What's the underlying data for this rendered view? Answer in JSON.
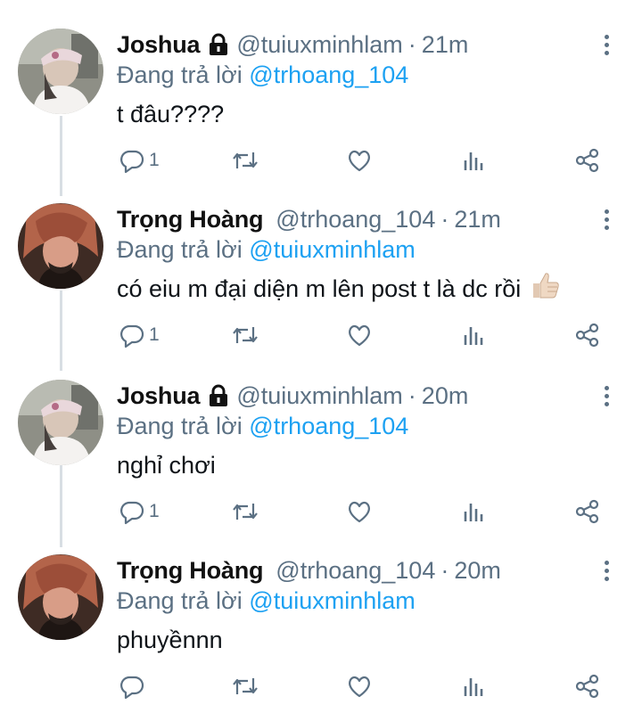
{
  "colors": {
    "link": "#1da1f2",
    "secondary": "#5b7083",
    "thread_line": "#d8dee3",
    "text": "#0f1419"
  },
  "reply_prefix": "Đang trả lời",
  "tweets": [
    {
      "name": "Joshua",
      "protected": true,
      "handle": "@tuiuxminhlam",
      "separator": "·",
      "time": "21m",
      "reply_to": "@trhoang_104",
      "text": "t đâu????",
      "emoji": "",
      "reply_count": "1"
    },
    {
      "name": "Trọng Hoàng",
      "protected": false,
      "handle": "@trhoang_104",
      "separator": "·",
      "time": "21m",
      "reply_to": "@tuiuxminhlam",
      "text": "có eiu m đại diện m lên post t là dc rồi",
      "emoji": "thumbs-up",
      "reply_count": "1"
    },
    {
      "name": "Joshua",
      "protected": true,
      "handle": "@tuiuxminhlam",
      "separator": "·",
      "time": "20m",
      "reply_to": "@trhoang_104",
      "text": "nghỉ chơi",
      "emoji": "",
      "reply_count": "1"
    },
    {
      "name": "Trọng Hoàng",
      "protected": false,
      "handle": "@trhoang_104",
      "separator": "·",
      "time": "20m",
      "reply_to": "@tuiuxminhlam",
      "text": "phuyềnnn",
      "emoji": "",
      "reply_count": ""
    }
  ],
  "icons": {
    "reply": "reply-icon",
    "retweet": "retweet-icon",
    "like": "heart-icon",
    "analytics": "analytics-icon",
    "share": "share-icon",
    "more": "more-vertical-icon",
    "lock": "lock-icon"
  }
}
